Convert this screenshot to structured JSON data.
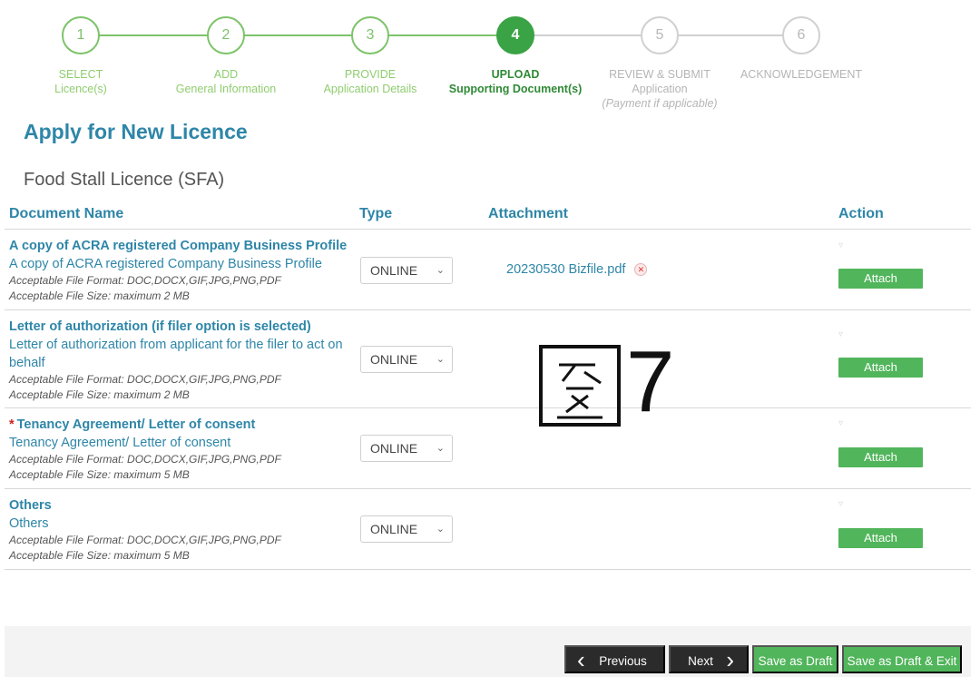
{
  "stepper": {
    "steps": [
      {
        "number": "1",
        "line1": "SELECT",
        "line2": "Licence(s)",
        "line3": ""
      },
      {
        "number": "2",
        "line1": "ADD",
        "line2": "General Information",
        "line3": ""
      },
      {
        "number": "3",
        "line1": "PROVIDE",
        "line2": "Application Details",
        "line3": ""
      },
      {
        "number": "4",
        "line1": "UPLOAD",
        "line2": "Supporting Document(s)",
        "line3": ""
      },
      {
        "number": "5",
        "line1": "REVIEW & SUBMIT",
        "line2": "Application",
        "line3": "(Payment if applicable)"
      },
      {
        "number": "6",
        "line1": "ACKNOWLEDGEMENT",
        "line2": "",
        "line3": ""
      }
    ]
  },
  "page": {
    "title": "Apply for New Licence",
    "licence": "Food Stall Licence (SFA)"
  },
  "table": {
    "headers": {
      "document": "Document Name",
      "type": "Type",
      "attachment": "Attachment",
      "action": "Action"
    },
    "rows": [
      {
        "required": false,
        "title": "A copy of ACRA registered Company Business Profile",
        "desc": "A copy of ACRA registered Company Business Profile",
        "format": "Acceptable File Format: DOC,DOCX,GIF,JPG,PNG,PDF",
        "size": "Acceptable File Size: maximum 2 MB",
        "type": "ONLINE",
        "attachment": "20230530 Bizfile.pdf",
        "action": "Attach"
      },
      {
        "required": false,
        "title": "Letter of authorization (if filer option is selected)",
        "desc": "Letter of authorization from applicant for the filer to act on behalf",
        "format": "Acceptable File Format: DOC,DOCX,GIF,JPG,PNG,PDF",
        "size": "Acceptable File Size: maximum 2 MB",
        "type": "ONLINE",
        "attachment": "",
        "action": "Attach"
      },
      {
        "required": true,
        "required_mark": "*",
        "title": "Tenancy Agreement/ Letter of consent",
        "desc": "Tenancy Agreement/ Letter of consent",
        "format": "Acceptable File Format: DOC,DOCX,GIF,JPG,PNG,PDF",
        "size": "Acceptable File Size: maximum 5 MB",
        "type": "ONLINE",
        "attachment": "",
        "action": "Attach"
      },
      {
        "required": false,
        "title": "Others",
        "desc": "Others",
        "format": "Acceptable File Format: DOC,DOCX,GIF,JPG,PNG,PDF",
        "size": "Acceptable File Size: maximum 5 MB",
        "type": "ONLINE",
        "attachment": "",
        "action": "Attach"
      }
    ]
  },
  "watermark": {
    "text": "7"
  },
  "footer": {
    "previous": "Previous",
    "next": "Next",
    "save_draft": "Save as Draft",
    "save_draft_exit": "Save as Draft & Exit"
  },
  "colors": {
    "brand_blue": "#2e86a8",
    "step_done": "#7dc36a",
    "step_current": "#3aa345",
    "button_green": "#51b55b",
    "button_dark": "#2b2b2b",
    "required_red": "#cc2222"
  }
}
